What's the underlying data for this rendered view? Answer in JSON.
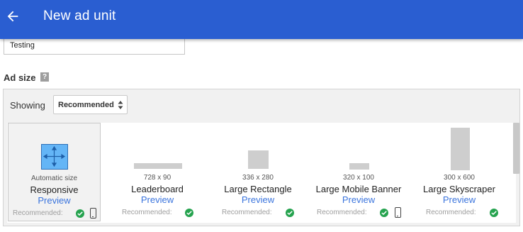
{
  "appbar": {
    "title": "New ad unit",
    "back_icon": "arrow-back-icon",
    "color": "#2a5ed1"
  },
  "form": {
    "name_value": "Testing"
  },
  "ad_size": {
    "label": "Ad size",
    "help_icon": "?"
  },
  "panel": {
    "showing_label": "Showing",
    "select_value": "Recommended",
    "recommended_label": "Recommended:",
    "preview_label": "Preview",
    "tiles": [
      {
        "size": "Automatic size",
        "name": "Responsive",
        "selected": true,
        "mobile": true
      },
      {
        "size": "728 x 90",
        "name": "Leaderboard",
        "mobile": false
      },
      {
        "size": "336 x 280",
        "name": "Large Rectangle",
        "mobile": false
      },
      {
        "size": "320 x 100",
        "name": "Large Mobile Banner",
        "mobile": true
      },
      {
        "size": "300 x 600",
        "name": "Large Skyscraper",
        "mobile": false
      }
    ]
  }
}
